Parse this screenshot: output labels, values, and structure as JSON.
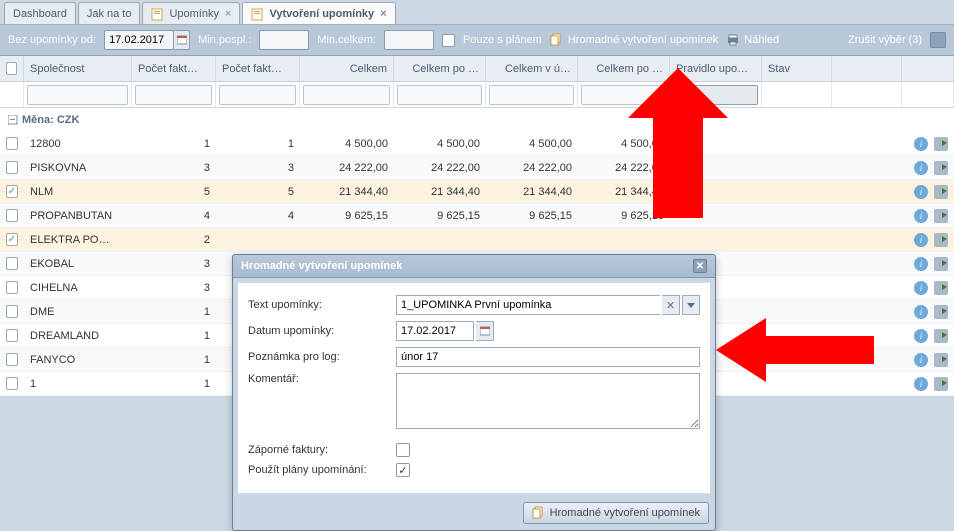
{
  "tabs": {
    "dashboard": "Dashboard",
    "howto": "Jak na to",
    "reminders": "Upomínky",
    "create": "Vytvoření upomínky"
  },
  "toolbar": {
    "no_reminder_from": "Bez upomínky od:",
    "date": "17.02.2017",
    "min_posp": "Min.pospl.:",
    "min_celkem": "Min.celkem:",
    "only_plan": "Pouze s plánem",
    "bulk": "Hromadné vytvoření upomínek",
    "preview": "Náhled",
    "cancel_selection": "Zrušit výběr (3)"
  },
  "columns": {
    "company": "Společnost",
    "inv1": "Počet fakt…",
    "inv2": "Počet fakt…",
    "total": "Celkem",
    "total_po": "Celkem po …",
    "total_vu": "Celkem v ú…",
    "total_po2": "Celkem po …",
    "rule": "Pravidlo upo…",
    "stav": "Stav"
  },
  "group": "Měna: CZK",
  "rows": [
    {
      "sel": false,
      "name": "12800",
      "c1": "1",
      "c2": "1",
      "a1": "4 500,00",
      "a2": "4 500,00",
      "a3": "4 500,00",
      "a4": "4 500,00"
    },
    {
      "sel": false,
      "name": "PISKOVNA",
      "c1": "3",
      "c2": "3",
      "a1": "24 222,00",
      "a2": "24 222,00",
      "a3": "24 222,00",
      "a4": "24 222,00"
    },
    {
      "sel": true,
      "name": "NLM",
      "c1": "5",
      "c2": "5",
      "a1": "21 344,40",
      "a2": "21 344,40",
      "a3": "21 344,40",
      "a4": "21 344,40"
    },
    {
      "sel": false,
      "name": "PROPANBUTAN",
      "c1": "4",
      "c2": "4",
      "a1": "9 625,15",
      "a2": "9 625,15",
      "a3": "9 625,15",
      "a4": "9 625,15"
    },
    {
      "sel": true,
      "name": "ELEKTRA PO…",
      "c1": "2",
      "c2": "",
      "a1": "",
      "a2": "",
      "a3": "",
      "a4": ""
    },
    {
      "sel": false,
      "name": "EKOBAL",
      "c1": "3",
      "c2": "",
      "a1": "",
      "a2": "",
      "a3": "",
      "a4": ""
    },
    {
      "sel": false,
      "name": "CIHELNA",
      "c1": "3",
      "c2": "",
      "a1": "",
      "a2": "",
      "a3": "",
      "a4": ""
    },
    {
      "sel": false,
      "name": "DME",
      "c1": "1",
      "c2": "",
      "a1": "",
      "a2": "",
      "a3": "",
      "a4": ""
    },
    {
      "sel": false,
      "name": "DREAMLAND",
      "c1": "1",
      "c2": "",
      "a1": "",
      "a2": "",
      "a3": "",
      "a4": ""
    },
    {
      "sel": false,
      "name": "FANYCO",
      "c1": "1",
      "c2": "",
      "a1": "",
      "a2": "",
      "a3": "",
      "a4": ""
    },
    {
      "sel": false,
      "name": "1",
      "c1": "1",
      "c2": "",
      "a1": "",
      "a2": "",
      "a3": "",
      "a4": ""
    }
  ],
  "dialog": {
    "title": "Hromadné vytvoření upomínek",
    "text_upominky": "Text upomínky:",
    "text_upominky_val": "1_UPOMINKA První upomínka",
    "datum": "Datum upomínky:",
    "datum_val": "17.02.2017",
    "poznamka": "Poznámka pro log:",
    "poznamka_val": "únor 17",
    "komentar": "Komentář:",
    "komentar_val": "",
    "zaporne": "Záporné faktury:",
    "pouzit": "Použít plány upomínání:",
    "submit": "Hromadné vytvoření upomínek"
  }
}
